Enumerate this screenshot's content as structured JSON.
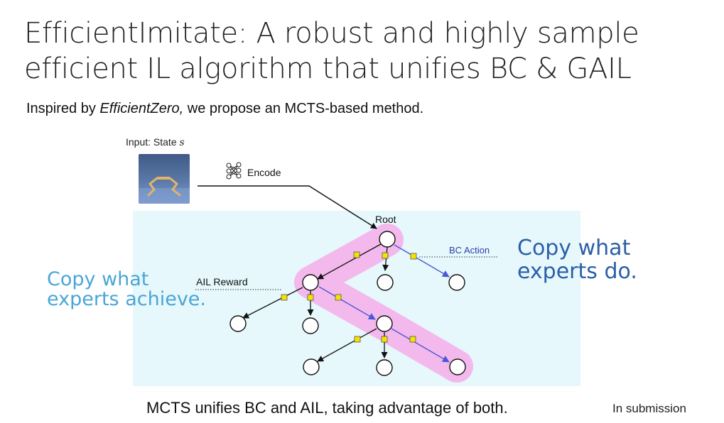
{
  "title_line1": "EfficientImitate: A robust and highly sample",
  "title_line2": "efficient IL algorithm that unifies BC & GAIL",
  "subtitle": {
    "pre": "Inspired by ",
    "emph": "EfficientZero,",
    "post": " we propose an MCTS-based method."
  },
  "diagram": {
    "input_label": "Input: State ",
    "input_var": "s",
    "encode_label": "Encode",
    "root_label": "Root",
    "bc_action_label": "BC Action",
    "ail_reward_label": "AIL Reward",
    "copy_left_line1": "Copy what",
    "copy_left_line2": "experts achieve.",
    "copy_right_line1": "Copy what",
    "copy_right_line2": "experts do."
  },
  "bottom_caption": "MCTS unifies BC and AIL, taking advantage of both.",
  "in_submission": "In submission",
  "colors": {
    "highlight": "#f3b9ec",
    "panel": "#e6f8fb",
    "bc_arrow": "#4b57d8",
    "reward_square": "#f4e300"
  }
}
